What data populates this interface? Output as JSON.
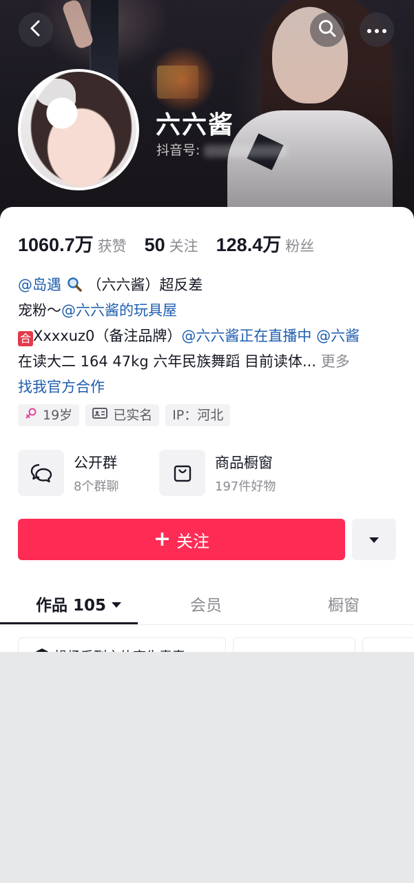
{
  "header": {
    "nickname": "六六酱",
    "douyin_id_label": "抖音号:",
    "icons": [
      "back-arrow-icon",
      "search-icon",
      "more-dots-icon"
    ]
  },
  "stats": [
    {
      "value": "1060.7万",
      "label": "获赞"
    },
    {
      "value": "50",
      "label": "关注"
    },
    {
      "value": "128.4万",
      "label": "粉丝"
    }
  ],
  "bio": {
    "line1_mention": "@岛遇",
    "line1_text": "（六六酱）超反差",
    "line2_text": " 宠粉～",
    "line2_mention": "@六六酱的玩具屋",
    "line3_badge": "合",
    "line3_text": "Xxxxuz0（备注品牌）",
    "line3_mention1": "@六六酱正在直播中",
    "line3_mention2": "@六酱",
    "line4_text": "在读大二 164 47kg 六年民族舞蹈 目前读体...",
    "line4_more": "更多",
    "line5_link": "找我官方合作"
  },
  "tags": [
    {
      "icon": "female-icon",
      "text": "19岁"
    },
    {
      "icon": "id-card-icon",
      "text": "已实名"
    },
    {
      "icon": "",
      "text": "IP：河北"
    }
  ],
  "entries": [
    {
      "icon": "chat-bubbles-icon",
      "title": "公开群",
      "subtitle": "8个群聊"
    },
    {
      "icon": "shopping-bag-icon",
      "title": "商品橱窗",
      "subtitle": "197件好物"
    }
  ],
  "actions": {
    "follow_label": "关注",
    "follow_plus": "+"
  },
  "tabs": [
    {
      "label": "作品 105",
      "active": true
    },
    {
      "label": "会员",
      "active": false
    },
    {
      "label": "橱窗",
      "active": false
    }
  ],
  "grid": {
    "first_caption": "操场系列之体育生青春"
  },
  "colors": {
    "accent": "#fe2c55",
    "link": "#1d5dae",
    "muted": "#8a8b91",
    "text": "#161823"
  }
}
